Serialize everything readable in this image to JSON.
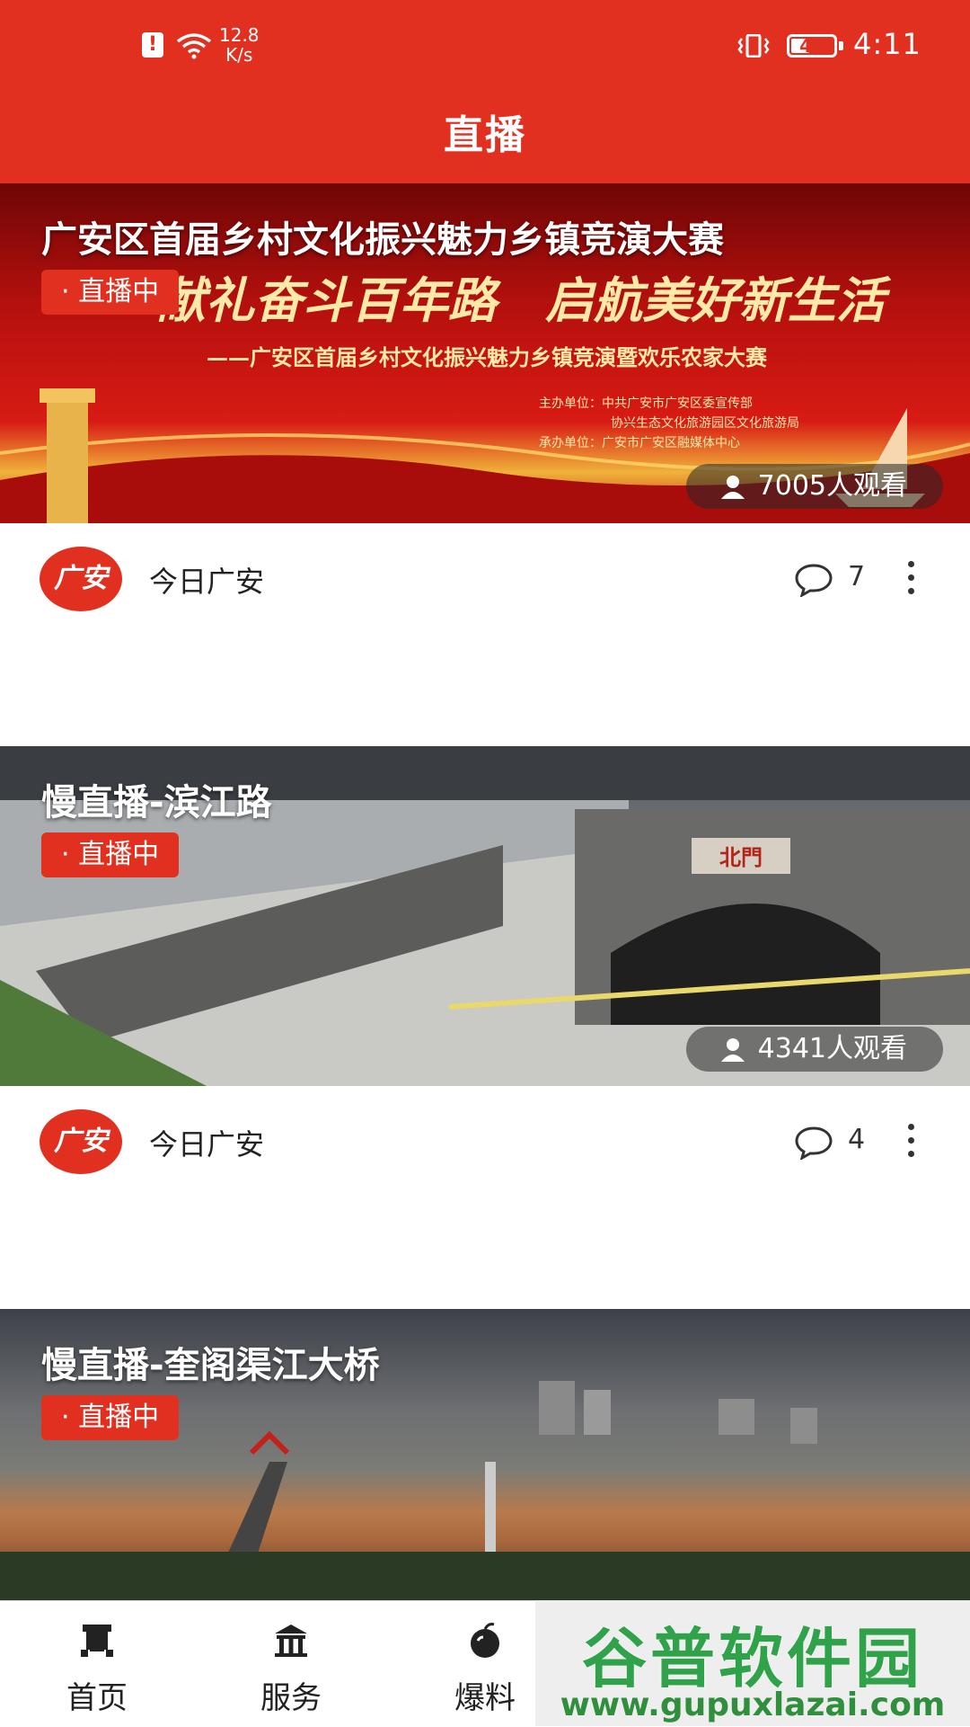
{
  "status_bar": {
    "alert_glyph": "!",
    "net_speed_value": "12.8",
    "net_speed_unit": "K/s",
    "battery": "48",
    "battery_level": 0.48,
    "time": "4:11"
  },
  "header": {
    "title": "直播"
  },
  "cards": [
    {
      "title": "广安区首届乡村文化振兴魅力乡镇竞演大赛",
      "badge": "· 直播中",
      "viewers": "7005人观看",
      "banner": {
        "slogan": "献礼奋斗百年路　启航美好新生活",
        "subtitle": "——广安区首届乡村文化振兴魅力乡镇竞演暨欢乐农家大赛",
        "organizer_1": "主办单位：中共广安市广安区委宣传部",
        "organizer_2": "协兴生态文化旅游园区文化旅游局",
        "organizer_3": "承办单位：广安市广安区融媒体中心"
      },
      "source": "今日广安",
      "avatar_text": "广安",
      "comments": "7"
    },
    {
      "title": "慢直播-滨江路",
      "badge": "· 直播中",
      "viewers": "4341人观看",
      "gate_sign": "北門",
      "source": "今日广安",
      "avatar_text": "广安",
      "comments": "4"
    },
    {
      "title": "慢直播-奎阁渠江大桥",
      "badge": "· 直播中"
    }
  ],
  "bottom_nav": [
    {
      "label": "首页",
      "icon": "home-icon"
    },
    {
      "label": "服务",
      "icon": "service-icon"
    },
    {
      "label": "爆料",
      "icon": "report-icon"
    }
  ],
  "watermark": {
    "brand": "谷普软件园",
    "url": "www.gupuxlazai.com"
  },
  "colors": {
    "accent": "#e1301f",
    "text": "#222222"
  }
}
